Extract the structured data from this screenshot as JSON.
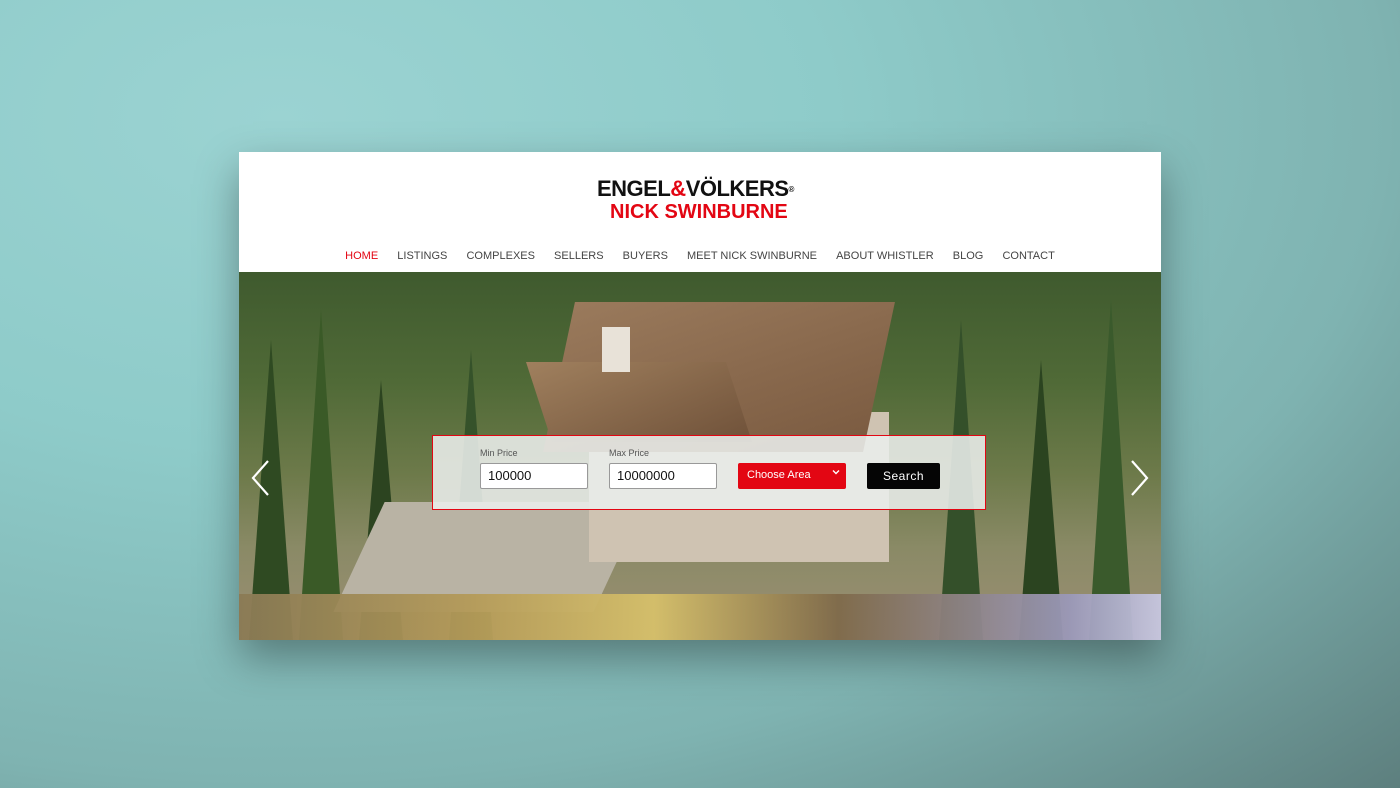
{
  "brand": {
    "line1_left": "ENGEL",
    "line1_amp": "&",
    "line1_right": "VÖLKERS",
    "registered": "®",
    "line2": "NICK SWINBURNE"
  },
  "nav": {
    "items": [
      {
        "label": "HOME",
        "active": true
      },
      {
        "label": "LISTINGS"
      },
      {
        "label": "COMPLEXES"
      },
      {
        "label": "SELLERS"
      },
      {
        "label": "BUYERS"
      },
      {
        "label": "MEET NICK SWINBURNE"
      },
      {
        "label": "ABOUT WHISTLER"
      },
      {
        "label": "BLOG"
      },
      {
        "label": "CONTACT"
      }
    ]
  },
  "search": {
    "min_label": "Min Price",
    "min_value": "100000",
    "max_label": "Max Price",
    "max_value": "10000000",
    "area_selected": "Choose Area",
    "button_label": "Search"
  },
  "colors": {
    "accent": "#e30613",
    "button": "#050505"
  },
  "icons": {
    "prev": "chevron-left-icon",
    "next": "chevron-right-icon",
    "select": "chevron-down-icon"
  }
}
